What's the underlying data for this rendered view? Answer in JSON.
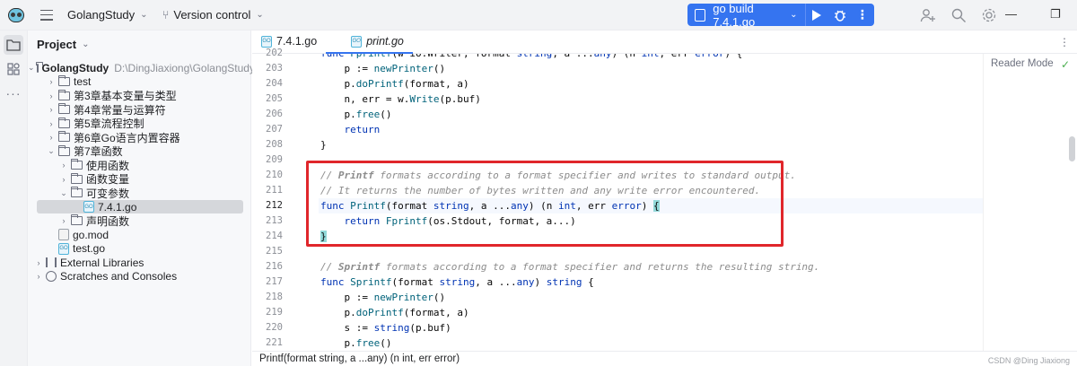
{
  "titlebar": {
    "project_name": "GolangStudy",
    "vcs_label": "Version control",
    "run_config_label": "go build 7.4.1.go"
  },
  "project_panel": {
    "title": "Project",
    "tree": [
      {
        "label": "GolangStudy",
        "hint": "D:\\DingJiaxiong\\GolangStudy",
        "bold": true,
        "depth": 0,
        "expanded": true,
        "kind": "folder"
      },
      {
        "label": "test",
        "depth": 1,
        "expanded": false,
        "kind": "folder"
      },
      {
        "label": "第3章基本变量与类型",
        "depth": 1,
        "expanded": false,
        "kind": "folder"
      },
      {
        "label": "第4章常量与运算符",
        "depth": 1,
        "expanded": false,
        "kind": "folder"
      },
      {
        "label": "第5章流程控制",
        "depth": 1,
        "expanded": false,
        "kind": "folder"
      },
      {
        "label": "第6章Go语言内置容器",
        "depth": 1,
        "expanded": false,
        "kind": "folder"
      },
      {
        "label": "第7章函数",
        "depth": 1,
        "expanded": true,
        "kind": "folder"
      },
      {
        "label": "使用函数",
        "depth": 2,
        "expanded": false,
        "kind": "folder"
      },
      {
        "label": "函数变量",
        "depth": 2,
        "expanded": false,
        "kind": "folder"
      },
      {
        "label": "可变参数",
        "depth": 2,
        "expanded": true,
        "kind": "folder"
      },
      {
        "label": "7.4.1.go",
        "depth": 3,
        "kind": "gofile",
        "selected": true
      },
      {
        "label": "声明函数",
        "depth": 2,
        "expanded": false,
        "kind": "folder"
      },
      {
        "label": "go.mod",
        "depth": 1,
        "kind": "modfile"
      },
      {
        "label": "test.go",
        "depth": 1,
        "kind": "gofile"
      },
      {
        "label": "External Libraries",
        "depth": 0,
        "expanded": false,
        "kind": "lib"
      },
      {
        "label": "Scratches and Consoles",
        "depth": 0,
        "expanded": false,
        "kind": "scratch"
      }
    ]
  },
  "editor": {
    "tabs": [
      {
        "label": "7.4.1.go",
        "active": false
      },
      {
        "label": "print.go",
        "active": true
      }
    ],
    "reader_mode": "Reader Mode",
    "current_line": 212,
    "lines": [
      {
        "n": "202",
        "html": "<span class=\"kw\">func</span> <span class=\"fn\">Fprintf</span>(w io.Writer, format <span class=\"ty\">string</span>, a ...<span class=\"ty\">any</span>) (n <span class=\"ty\">int</span>, err <span class=\"ty\">error</span>) {"
      },
      {
        "n": "203",
        "html": "    p := <span class=\"call\">newPrinter</span>()"
      },
      {
        "n": "204",
        "html": "    p.<span class=\"call\">doPrintf</span>(format, a)"
      },
      {
        "n": "205",
        "html": "    n, err = w.<span class=\"call\">Write</span>(p.buf)"
      },
      {
        "n": "206",
        "html": "    p.<span class=\"call\">free</span>()"
      },
      {
        "n": "207",
        "html": "    <span class=\"kw\">return</span>"
      },
      {
        "n": "208",
        "html": "}"
      },
      {
        "n": "209",
        "html": ""
      },
      {
        "n": "210",
        "html": "<span class=\"cm\">// </span><span class=\"cm-b\">Printf</span><span class=\"cm\"> formats according to a format specifier and writes to standard output.</span>"
      },
      {
        "n": "211",
        "html": "<span class=\"cm\">// It returns the number of bytes written and any write error encountered.</span>"
      },
      {
        "n": "212",
        "html": "<span class=\"kw\">func</span> <span class=\"fn\">Printf</span>(format <span class=\"ty\">string</span>, a ...<span class=\"ty\">any</span>) (n <span class=\"ty\">int</span>, err <span class=\"ty\">error</span>) <span class=\"brace-match\">{</span>"
      },
      {
        "n": "213",
        "html": "    <span class=\"kw\">return</span> <span class=\"call\">Fprintf</span>(os.Stdout, format, a...)"
      },
      {
        "n": "214",
        "html": "<span class=\"brace-match\">}</span>"
      },
      {
        "n": "215",
        "html": ""
      },
      {
        "n": "216",
        "html": "<span class=\"cm\">// </span><span class=\"cm-b\">Sprintf</span><span class=\"cm\"> formats according to a format specifier and returns the resulting string.</span>"
      },
      {
        "n": "217",
        "html": "<span class=\"kw\">func</span> <span class=\"fn\">Sprintf</span>(format <span class=\"ty\">string</span>, a ...<span class=\"ty\">any</span>) <span class=\"ty\">string</span> {"
      },
      {
        "n": "218",
        "html": "    p := <span class=\"call\">newPrinter</span>()"
      },
      {
        "n": "219",
        "html": "    p.<span class=\"call\">doPrintf</span>(format, a)"
      },
      {
        "n": "220",
        "html": "    s := <span class=\"ty\">string</span>(p.buf)"
      },
      {
        "n": "221",
        "html": "    p.<span class=\"call\">free</span>()"
      }
    ]
  },
  "statusbar": {
    "text": "Printf(format string, a ...any) (n int, err error)",
    "watermark": "CSDN @Ding Jiaxiong"
  },
  "colors": {
    "accent": "#3574f0",
    "highlight_box": "#e0262b"
  }
}
